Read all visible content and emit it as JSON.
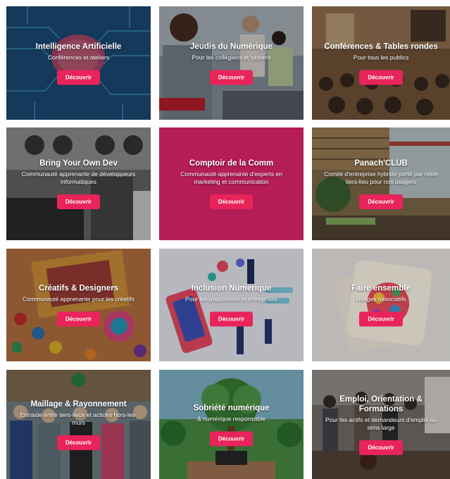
{
  "cards": [
    {
      "title": "Intelligence Artificielle",
      "subtitle": "Conférences et ateliers",
      "button": "Découvrir",
      "image": "circuit-brain",
      "color": "#1d4f7d"
    },
    {
      "title": "Jeudis du Numérique",
      "subtitle": "Pour les collégiens et lycéens",
      "button": "Découvrir",
      "image": "students-photo",
      "color": "#6f7e8c"
    },
    {
      "title": "Conférences & Tables rondes",
      "subtitle": "Pour tous les publics",
      "button": "Découvrir",
      "image": "audience-photo",
      "color": "#6b4a32"
    },
    {
      "title": "Bring Your Own Dev",
      "subtitle": "Communauté apprenante de développeurs informatiques",
      "button": "Découvrir",
      "image": "vintage-computers",
      "color": "#555555"
    },
    {
      "title": "Comptoir de la Comm",
      "subtitle": "Communauté apprenante d'experts en marketing et communication",
      "button": "Découvrir",
      "image": "solid-color",
      "color": "#b51d57"
    },
    {
      "title": "Panach'CLUB",
      "subtitle": "Comité d'entreprise hybride porté par notre tiers-lieu pour nos usagers",
      "button": "Découvrir",
      "image": "tiers-lieu-interior",
      "color": "#7b6a48"
    },
    {
      "title": "Créatifs & Designers",
      "subtitle": "Communauté apprenante pour les créatifs",
      "button": "Découvrir",
      "image": "colorful-palette",
      "color": "#b5643a"
    },
    {
      "title": "Inclusion Numérique",
      "subtitle": "Pour les populations et entreprises",
      "button": "Découvrir",
      "image": "digital-illustration",
      "color": "#d9dbe3"
    },
    {
      "title": "Faire ensemble",
      "subtitle": "Usages associatifs",
      "button": "Découvrir",
      "image": "coaster-illustration",
      "color": "#d9d6d2"
    },
    {
      "title": "Maillage & Rayonnement",
      "subtitle": "Entraide entre tiers-lieux et actions hors-les-murs",
      "button": "Découvrir",
      "image": "group-photo",
      "color": "#5d6a70"
    },
    {
      "title": "Sobriété numérique",
      "subtitle": "& numérique responsable",
      "button": "Découvrir",
      "image": "tree-laptop",
      "color": "#4f8f55"
    },
    {
      "title": "Emploi, Orientation & Formations",
      "subtitle": "Pour les actifs et demandeurs d'emploi au sens large",
      "button": "Découvrir",
      "image": "job-fair-photo",
      "color": "#6a6560"
    }
  ]
}
